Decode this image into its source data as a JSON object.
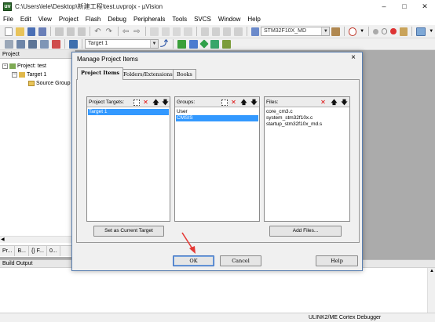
{
  "window": {
    "title": "C:\\Users\\lele\\Desktop\\新建工程\\test.uvprojx - µVision",
    "app_icon": "uv"
  },
  "menu": [
    "File",
    "Edit",
    "View",
    "Project",
    "Flash",
    "Debug",
    "Peripherals",
    "Tools",
    "SVCS",
    "Window",
    "Help"
  ],
  "toolbar": {
    "device_combo": "STM32F10X_MD",
    "target_combo": "Target 1"
  },
  "project_pane": {
    "title": "Project",
    "tree": [
      {
        "label": "Project: test",
        "level": 0,
        "expander": "⊟"
      },
      {
        "label": "Target 1",
        "level": 1,
        "expander": "⊟"
      },
      {
        "label": "Source Group",
        "level": 2,
        "expander": ""
      }
    ],
    "tabs": [
      "Pr...",
      "B...",
      "{} F...",
      "0..."
    ]
  },
  "build_output": {
    "title": "Build Output"
  },
  "statusbar": {
    "debugger": "ULINK2/ME Cortex Debugger"
  },
  "dialog": {
    "title": "Manage Project Items",
    "close": "×",
    "tabs": [
      "Project Items",
      "Folders/Extensions",
      "Books"
    ],
    "active_tab": 0,
    "targets": {
      "label": "Project Targets:",
      "items": [
        "Target 1"
      ],
      "selected": 0
    },
    "groups": {
      "label": "Groups:",
      "items": [
        "User",
        "CMSIS"
      ],
      "selected": 1
    },
    "files": {
      "label": "Files:",
      "items": [
        "core_cm3.c",
        "system_stm32f10x.c",
        "startup_stm32f10x_md.s"
      ]
    },
    "set_current_label": "Set as Current Target",
    "add_files_label": "Add Files...",
    "ok_label": "OK",
    "cancel_label": "Cancel",
    "help_label": "Help"
  },
  "colors": {
    "selection": "#3399ff",
    "annotation_arrow": "#e53935",
    "dialog_border": "#5a7fb0"
  }
}
